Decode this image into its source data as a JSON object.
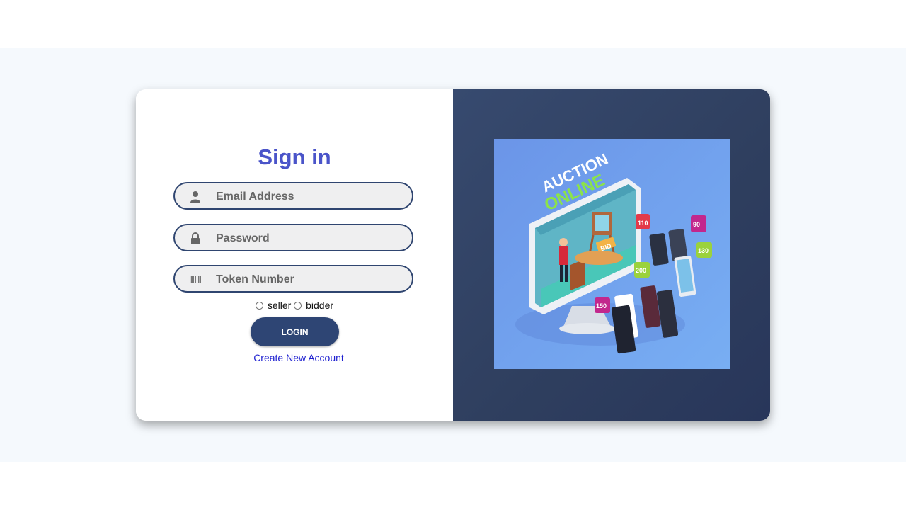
{
  "form": {
    "title": "Sign in",
    "email_placeholder": "Email Address",
    "password_placeholder": "Password",
    "token_placeholder": "Token Number",
    "role_seller": "seller",
    "role_bidder": "bidder",
    "login_label": "LOGIN",
    "create_account_label": "Create New Account"
  },
  "illustration": {
    "heading_line1": "AUCTION",
    "heading_line2": "ONLINE",
    "bid_label": "BID",
    "bubbles": [
      "110",
      "90",
      "130",
      "200",
      "150"
    ]
  },
  "colors": {
    "accent_title": "#4a54c9",
    "button": "#2e4574",
    "link": "#1d1fd0",
    "panel": "#2f3f5f"
  }
}
